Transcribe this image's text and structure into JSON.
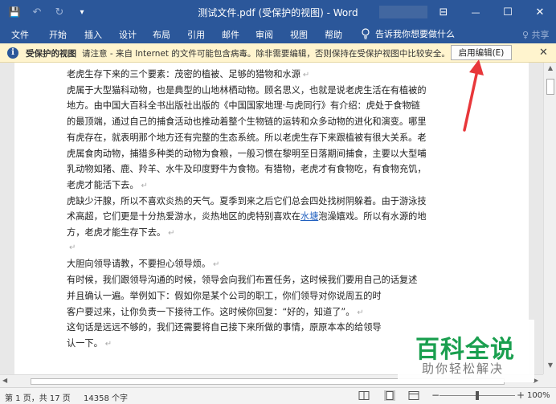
{
  "window": {
    "title": "测试文件.pdf (受保护的视图) - Word",
    "controls": {
      "ribbon_options": "⊟",
      "minimize": "—",
      "maximize": "☐",
      "close": "✕"
    }
  },
  "qat": {
    "save": "💾",
    "undo": "↶",
    "redo": "↻",
    "customize": "▾"
  },
  "ribbon": {
    "tabs": [
      "文件",
      "开始",
      "插入",
      "设计",
      "布局",
      "引用",
      "邮件",
      "审阅",
      "视图",
      "帮助"
    ],
    "tell_me": "告诉我你想要做什么",
    "share": "♀ 共享"
  },
  "protected_bar": {
    "title": "受保护的视图",
    "message": "请注意 - 来自 Internet 的文件可能包含病毒。除非需要编辑，否则保持在受保护视图中比较安全。",
    "enable_button": "启用编辑(E)",
    "close": "✕"
  },
  "document": {
    "lines": [
      {
        "text": "老虎生存下来的三个要素：茂密的植被、足够的猎物和水源",
        "mark": true
      },
      {
        "text": "虎属于大型猫科动物，也是典型的山地林栖动物。顾名思义，也就是说老虎生活在有植被的"
      },
      {
        "text": "地方。由中国大百科全书出版社出版的《中国国家地理·与虎同行》有介绍：虎处于食物链"
      },
      {
        "text": "的最顶端，通过自己的捕食活动也推动着整个生物链的运转和众多动物的进化和演变。哪里"
      },
      {
        "text": "有虎存在，就表明那个地方还有完整的生态系统。所以老虎生存下来跟植被有很大关系。老"
      },
      {
        "text": "虎属食肉动物，捕猎多种类的动物为食粮，一般习惯在黎明至日落期间捕食，主要以大型哺"
      },
      {
        "text": "乳动物如猪、鹿、羚羊、水牛及印度野牛为食物。有猎物，老虎才有食物吃，有食物充饥，"
      },
      {
        "text": "老虎才能活下去。",
        "mark": true
      },
      {
        "text": "虎缺少汗腺，所以不喜欢炎热的天气。夏季到来之后它们总会四处找树阴躲着。由于游泳技"
      },
      {
        "pre": "术高超，它们更是十分热爱游水，炎热地区的虎特别喜欢在",
        "link": "水塘",
        "post": "泡澡嬉戏。所以有水源的地"
      },
      {
        "text": "方，老虎才能生存下去。",
        "mark": true
      },
      {
        "text": "",
        "mark": true
      },
      {
        "text": "大胆向领导请教，不要担心领导烦。",
        "mark": true
      },
      {
        "text": "有时候，我们跟领导沟通的时候，领导会向我们布置任务，这时候我们要用自己的话复述"
      },
      {
        "text": "并且确认一遍。举例如下：假如你是某个公司的职工，你们领导对你说周五的时"
      },
      {
        "text": "客户要过来，让你负责一下接待工作。这时候你回复：“好的，知道了”。",
        "mark": true
      },
      {
        "text": "这句话是远远不够的，我们还需要将自己接下来所做的事情，原原本本的给领导"
      },
      {
        "text": "认一下。",
        "mark": true
      }
    ],
    "paragraph_mark": "↵"
  },
  "scrollbars": {
    "up": "▲",
    "down": "▼",
    "left": "◀",
    "right": "▶"
  },
  "status": {
    "page": "第 1 页，共 17 页",
    "words": "14358 个字",
    "zoom_level": "100%",
    "zoom_fraction": 0.5,
    "zoom_minus": "−",
    "zoom_plus": "+"
  },
  "watermark": {
    "line1": "百科全说",
    "line2": "助你轻松解决"
  },
  "colors": {
    "brand": "#2b579a",
    "protected_bar": "#fff4ce",
    "arrow": "#e8373a",
    "watermark_green": "#1a9f4f",
    "link": "#1f5fbf"
  }
}
